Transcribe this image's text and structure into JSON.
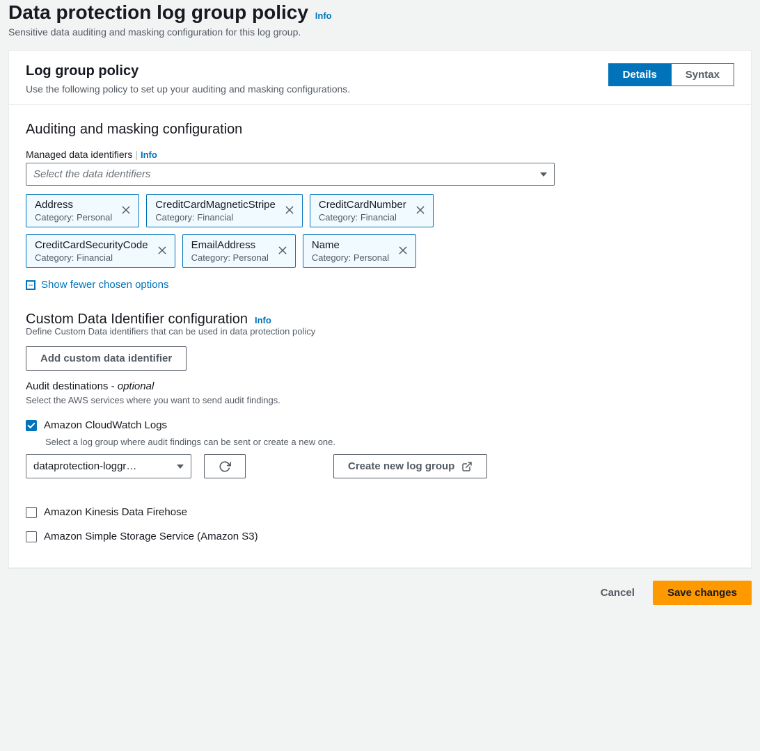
{
  "page": {
    "title": "Data protection log group policy",
    "info": "Info",
    "subtitle": "Sensitive data auditing and masking configuration for this log group."
  },
  "panel": {
    "title": "Log group policy",
    "desc": "Use the following policy to set up your auditing and masking configurations.",
    "tabs": {
      "details": "Details",
      "syntax": "Syntax"
    }
  },
  "audit": {
    "heading": "Auditing and masking configuration",
    "field_label": "Managed data identifiers",
    "field_info": "Info",
    "select_placeholder": "Select the data identifiers",
    "tokens": [
      {
        "name": "Address",
        "cat": "Category: Personal"
      },
      {
        "name": "CreditCardMagneticStripe",
        "cat": "Category: Financial"
      },
      {
        "name": "CreditCardNumber",
        "cat": "Category: Financial"
      },
      {
        "name": "CreditCardSecurityCode",
        "cat": "Category: Financial"
      },
      {
        "name": "EmailAddress",
        "cat": "Category: Personal"
      },
      {
        "name": "Name",
        "cat": "Category: Personal"
      }
    ],
    "toggle": "Show fewer chosen options"
  },
  "custom": {
    "heading": "Custom Data Identifier configuration",
    "info": "Info",
    "desc": "Define Custom Data identifiers that can be used in data protection policy",
    "add_btn": "Add custom data identifier"
  },
  "dest": {
    "label": "Audit destinations - ",
    "optional": "optional",
    "desc": "Select the AWS services where you want to send audit findings.",
    "cw": {
      "label": "Amazon CloudWatch Logs",
      "desc": "Select a log group where audit findings can be sent or create a new one.",
      "select_value": "dataprotection-loggr…",
      "create_btn": "Create new log group"
    },
    "firehose": "Amazon Kinesis Data Firehose",
    "s3": "Amazon Simple Storage Service (Amazon S3)"
  },
  "footer": {
    "cancel": "Cancel",
    "save": "Save changes"
  }
}
